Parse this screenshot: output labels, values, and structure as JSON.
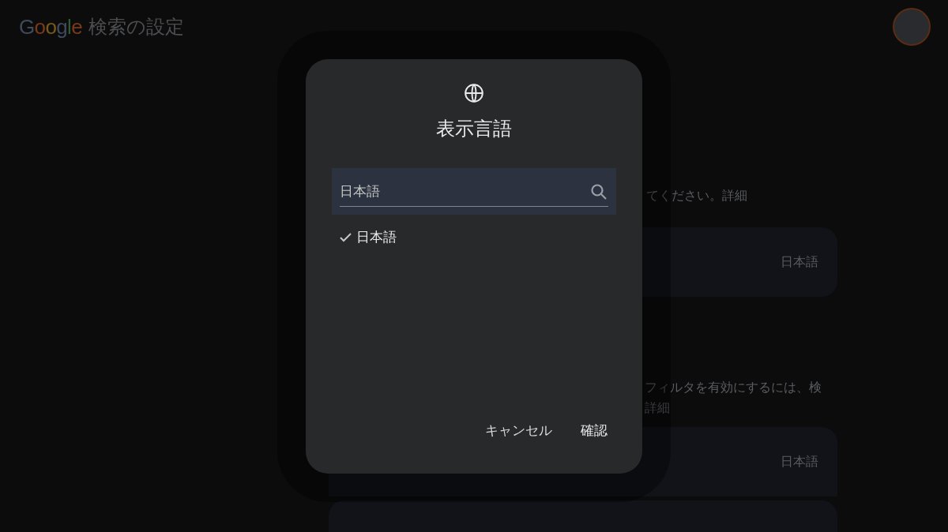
{
  "header": {
    "logo": "Google",
    "title": "検索の設定"
  },
  "page": {
    "intro_fragment": "てください。詳細",
    "cards": [
      {
        "value": "日本語"
      },
      {
        "value": "日本語"
      }
    ],
    "filter_text_lines": [
      "フィルタを有効にするには、検",
      "詳細"
    ]
  },
  "dialog": {
    "title": "表示言語",
    "search": {
      "value": "日本語"
    },
    "options": [
      {
        "label": "日本語",
        "selected": true
      }
    ],
    "buttons": [
      {
        "label": "キャンセル",
        "kind": "cancel"
      },
      {
        "label": "確認",
        "kind": "confirm"
      }
    ]
  }
}
